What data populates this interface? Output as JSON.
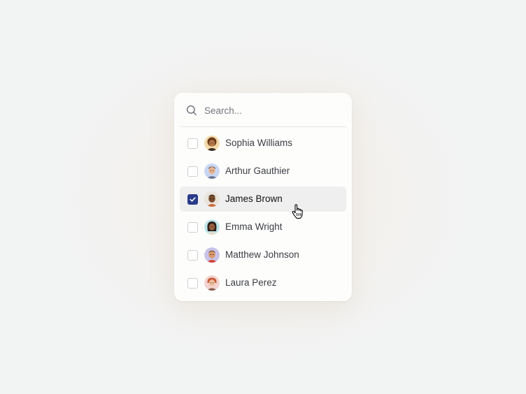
{
  "search": {
    "placeholder": "Search...",
    "value": ""
  },
  "people": [
    {
      "name": "Sophia Williams",
      "checked": false,
      "avatar": "avatar-sophia-williams"
    },
    {
      "name": "Arthur Gauthier",
      "checked": false,
      "avatar": "avatar-arthur-gauthier"
    },
    {
      "name": "James Brown",
      "checked": true,
      "avatar": "avatar-james-brown"
    },
    {
      "name": "Emma Wright",
      "checked": false,
      "avatar": "avatar-emma-wright"
    },
    {
      "name": "Matthew Johnson",
      "checked": false,
      "avatar": "avatar-matthew-johnson"
    },
    {
      "name": "Laura Perez",
      "checked": false,
      "avatar": "avatar-laura-perez"
    }
  ],
  "colors": {
    "checkbox_checked": "#2a3c8a",
    "selected_row_bg": "#efefef"
  },
  "icons": {
    "search": "search-icon",
    "check": "check-icon",
    "cursor": "pointer-hand-cursor"
  }
}
